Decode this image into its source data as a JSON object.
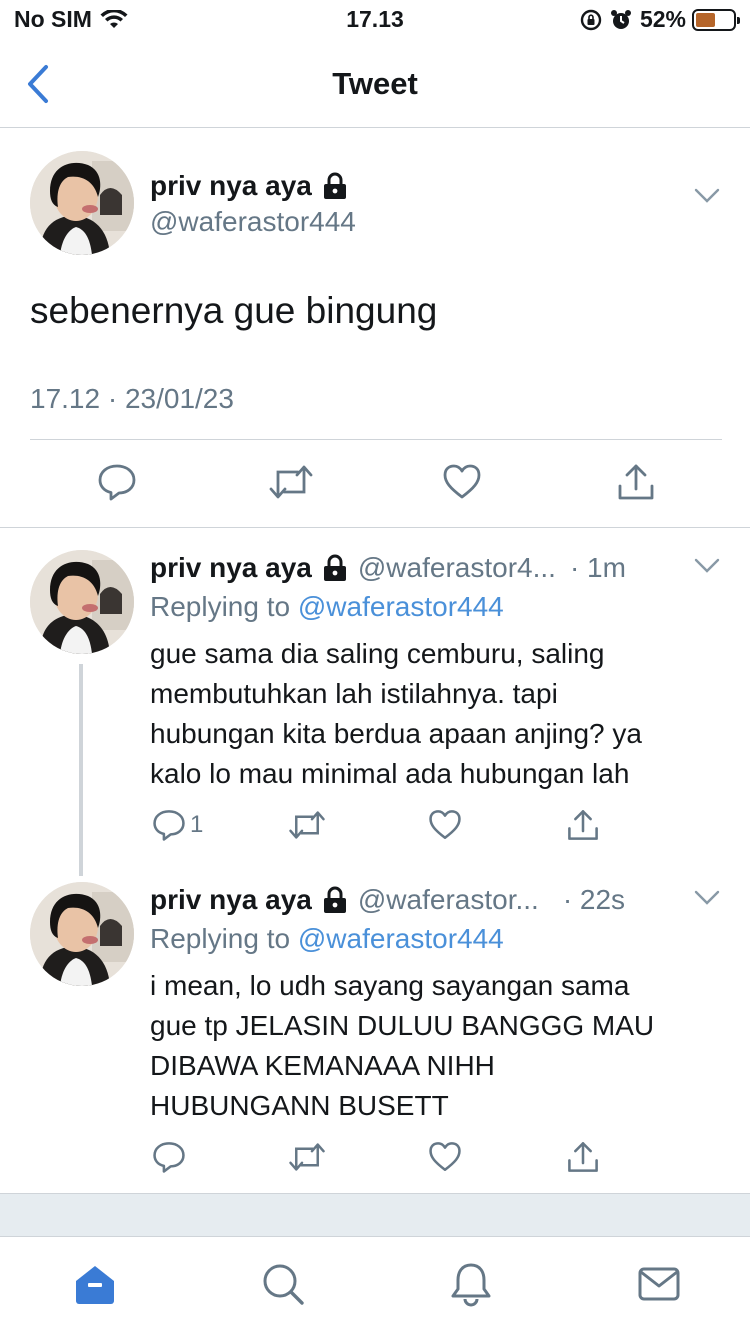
{
  "status_bar": {
    "carrier": "No SIM",
    "time": "17.13",
    "battery_percent": "52%",
    "battery_level": 0.52,
    "battery_color": "#b5652a"
  },
  "nav": {
    "title": "Tweet"
  },
  "main_tweet": {
    "name": "priv nya aya",
    "handle": "@waferastor444",
    "text": "sebenernya gue bingung",
    "timestamp": "17.12 · 23/01/23"
  },
  "replies": [
    {
      "name": "priv nya aya",
      "handle": "@waferastor4...",
      "time": "· 1m",
      "replying_prefix": "Replying to",
      "replying_to": "@waferastor444",
      "lines": [
        "gue sama dia saling cemburu, saling",
        "membutuhkan lah istilahnya. tapi",
        "hubungan kita berdua apaan anjing? ya",
        "kalo lo mau minimal ada hubungan lah"
      ],
      "reply_count": "1"
    },
    {
      "name": "priv nya aya",
      "handle": "@waferastor...",
      "time": "· 22s",
      "replying_prefix": "Replying to",
      "replying_to": "@waferastor444",
      "lines": [
        "i mean, lo udh sayang sayangan sama",
        "gue tp JELASIN DULUU BANGGG MAU",
        "DIBAWA KEMANAAA NIHH",
        "HUBUNGANN BUSETT"
      ],
      "reply_count": ""
    }
  ],
  "tab_bar": {
    "icons": [
      "home-icon",
      "search-icon",
      "notifications-icon",
      "messages-icon"
    ],
    "active_color": "#3a7bd5"
  },
  "colors": {
    "link": "#4a90d9",
    "secondary_text": "#657786",
    "back_arrow": "#3a7bd5"
  }
}
